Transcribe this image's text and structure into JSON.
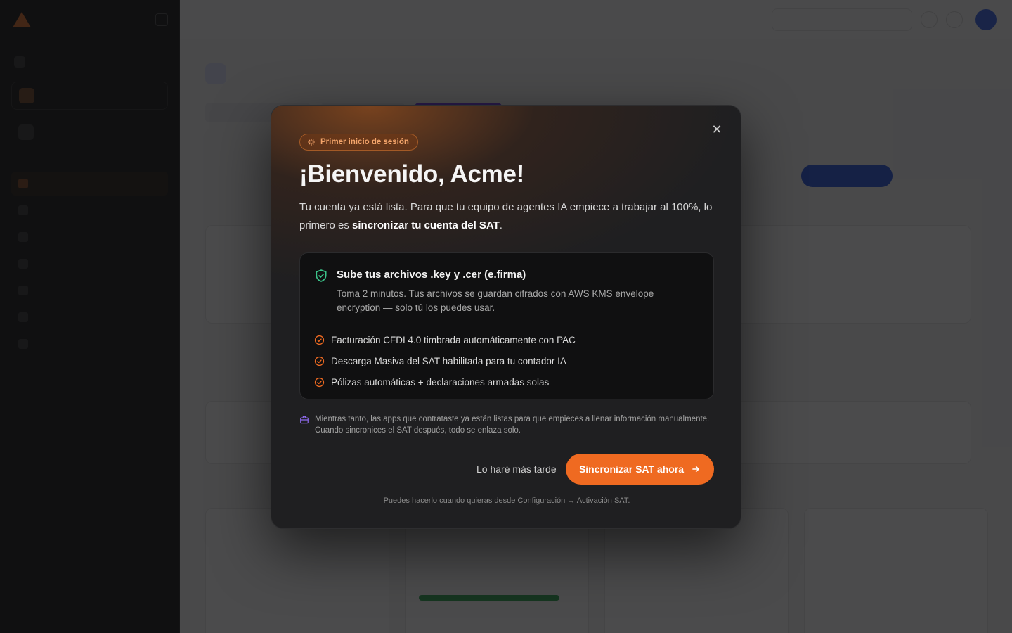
{
  "modal": {
    "badge": "Primer inicio de sesión",
    "title": "¡Bienvenido, Acme!",
    "lead_part1": "Tu cuenta ya está lista. Para que tu equipo de agentes IA empiece a trabajar al 100%, lo primero es ",
    "lead_strong": "sincronizar tu cuenta del SAT",
    "lead_part2": ".",
    "box": {
      "title": "Sube tus archivos .key y .cer (e.firma)",
      "description": "Toma 2 minutos. Tus archivos se guardan cifrados con AWS KMS envelope encryption — solo tú los puedes usar.",
      "items": [
        "Facturación CFDI 4.0 timbrada automáticamente con PAC",
        "Descarga Masiva del SAT habilitada para tu contador IA",
        "Pólizas automáticas + declaraciones armadas solas"
      ]
    },
    "note": "Mientras tanto, las apps que contrataste ya están listas para que empieces a llenar información manualmente. Cuando sincronices el SAT después, todo se enlaza solo.",
    "later_label": "Lo haré más tarde",
    "primary_label": "Sincronizar SAT ahora",
    "footnote": "Puedes hacerlo cuando quieras desde Configuración → Activación SAT.",
    "close_symbol": "✕"
  },
  "colors": {
    "accent": "#ef6a21",
    "badge_text": "#f4a56b",
    "shield": "#3bc48a",
    "note_icon": "#8f6bf0"
  },
  "icons": {
    "badge": "sparkle-icon",
    "box": "shield-check-icon",
    "items": "check-circle-icon",
    "note": "briefcase-icon",
    "primary": "arrow-right-icon",
    "close": "close-icon"
  }
}
